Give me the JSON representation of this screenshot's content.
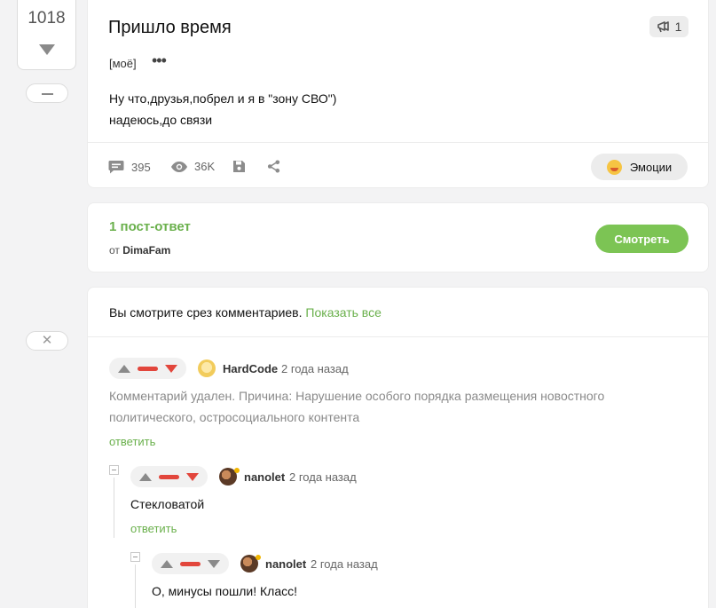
{
  "rail": {
    "rating": "1018",
    "minus_symbol": "—",
    "close_symbol": "✕"
  },
  "post": {
    "title": "Пришло время",
    "badge_count": "1",
    "tag": "[моё]",
    "more_icon": "•••",
    "body_lines": [
      "Ну что,друзья,побрел и я в \"зону СВО\")",
      "надеюсь,до связи"
    ],
    "stats": {
      "comments": "395",
      "views": "36K"
    },
    "emotions_label": "Эмоции"
  },
  "reply_post": {
    "title": "1 пост-ответ",
    "from_prefix": "от",
    "from_author": "DimaFam",
    "watch_label": "Смотреть"
  },
  "comments_section": {
    "slice_note": "Вы смотрите срез комментариев.",
    "show_all": "Показать все",
    "comments": [
      {
        "author": "HardCode",
        "time": "2 года назад",
        "text_lines": [
          "Комментарий удален. Причина: Нарушение особого порядка размещения новостного",
          "политического, остросоциального контента"
        ],
        "reply_label": "ответить"
      },
      {
        "author": "nanolet",
        "time": "2 года назад",
        "text_lines": [
          "Стекловатой"
        ],
        "reply_label": "ответить"
      },
      {
        "author": "nanolet",
        "time": "2 года назад",
        "text_lines": [
          "О, минусы пошли! Класс!"
        ]
      }
    ]
  },
  "colors": {
    "accent_green": "#6ab04c",
    "button_green": "#7cc454",
    "vote_red": "#e2463c",
    "background": "#f3f3f4"
  }
}
